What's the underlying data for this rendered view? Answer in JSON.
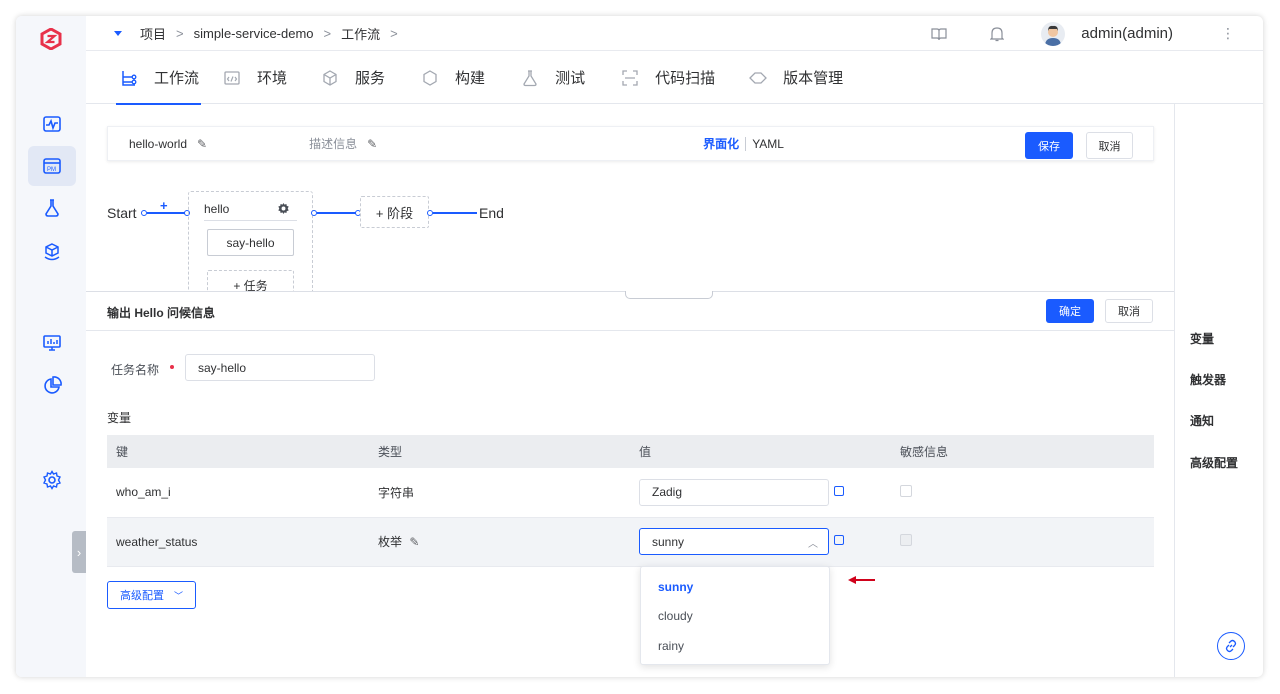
{
  "breadcrumb": {
    "items": [
      "项目",
      "simple-service-demo",
      "工作流"
    ]
  },
  "header": {
    "user": "admin(admin)"
  },
  "tabs": [
    {
      "label": "工作流",
      "icon": "workflow-icon"
    },
    {
      "label": "环境",
      "icon": "environment-icon"
    },
    {
      "label": "服务",
      "icon": "service-icon"
    },
    {
      "label": "构建",
      "icon": "build-icon"
    },
    {
      "label": "测试",
      "icon": "test-flask-icon"
    },
    {
      "label": "代码扫描",
      "icon": "scan-icon"
    },
    {
      "label": "版本管理",
      "icon": "version-icon"
    }
  ],
  "editor": {
    "name": "hello-world",
    "description_placeholder": "描述信息",
    "mode_visual": "界面化",
    "mode_yaml": "YAML",
    "save": "保存",
    "cancel": "取消"
  },
  "flow": {
    "start": "Start",
    "end": "End",
    "add_stage": "+ 阶段",
    "stage_name": "hello",
    "job": "say-hello",
    "add_job": "+ 任务"
  },
  "right_panel": {
    "items": [
      "变量",
      "触发器",
      "通知",
      "高级配置"
    ]
  },
  "drawer": {
    "title": "输出 Hello 问候信息",
    "confirm": "确定",
    "cancel": "取消",
    "task_name_label": "任务名称",
    "task_name_value": "say-hello",
    "vars_title": "变量",
    "columns": [
      "键",
      "类型",
      "值",
      "敏感信息"
    ],
    "rows": [
      {
        "key": "who_am_i",
        "type": "字符串",
        "value": "Zadig"
      },
      {
        "key": "weather_status",
        "type": "枚举",
        "value": "sunny"
      }
    ],
    "advanced": "高级配置",
    "options": [
      "sunny",
      "cloudy",
      "rainy"
    ],
    "selected_option": "sunny"
  },
  "colors": {
    "accent": "#1a5bff",
    "brand": "#e8314a",
    "annotation_arrow": "#d0021b"
  }
}
